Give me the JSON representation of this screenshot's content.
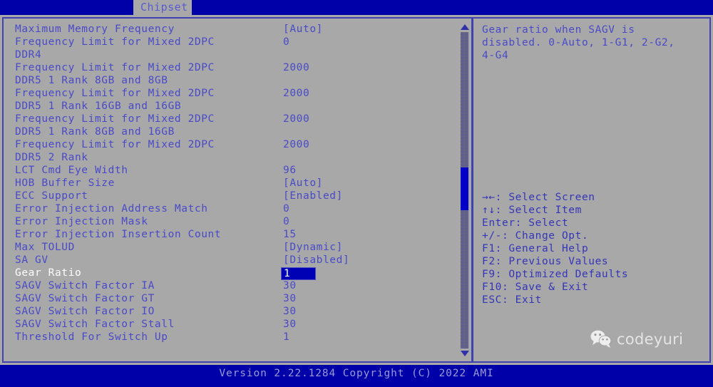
{
  "menu": {
    "active_tab": "Chipset",
    "tabs": [
      "Chipset"
    ]
  },
  "settings": {
    "rows": [
      {
        "label": "Maximum Memory Frequency",
        "value": "[Auto]",
        "selected": false
      },
      {
        "label": "Frequency Limit for Mixed 2DPC",
        "value": "0",
        "selected": false
      },
      {
        "label": "DDR4",
        "value": "",
        "selected": false
      },
      {
        "label": "Frequency Limit for Mixed 2DPC",
        "value": "2000",
        "selected": false
      },
      {
        "label": "DDR5 1 Rank 8GB and 8GB",
        "value": "",
        "selected": false
      },
      {
        "label": "Frequency Limit for Mixed 2DPC",
        "value": "2000",
        "selected": false
      },
      {
        "label": "DDR5 1 Rank 16GB and 16GB",
        "value": "",
        "selected": false
      },
      {
        "label": "Frequency Limit for Mixed 2DPC",
        "value": "2000",
        "selected": false
      },
      {
        "label": "DDR5 1 Rank 8GB and 16GB",
        "value": "",
        "selected": false
      },
      {
        "label": "Frequency Limit for Mixed 2DPC",
        "value": "2000",
        "selected": false
      },
      {
        "label": "DDR5 2 Rank",
        "value": "",
        "selected": false
      },
      {
        "label": "LCT Cmd Eye Width",
        "value": "96",
        "selected": false
      },
      {
        "label": "HOB Buffer Size",
        "value": "[Auto]",
        "selected": false
      },
      {
        "label": "ECC Support",
        "value": "[Enabled]",
        "selected": false
      },
      {
        "label": "Error Injection Address Match",
        "value": "0",
        "selected": false
      },
      {
        "label": "Error Injection Mask",
        "value": "0",
        "selected": false
      },
      {
        "label": "Error Injection Insertion Count",
        "value": "15",
        "selected": false
      },
      {
        "label": "Max TOLUD",
        "value": "[Dynamic]",
        "selected": false
      },
      {
        "label": "SA GV",
        "value": "[Disabled]",
        "selected": false
      },
      {
        "label": "Gear Ratio",
        "value": "1",
        "selected": true
      },
      {
        "label": "SAGV Switch Factor IA",
        "value": "30",
        "selected": false
      },
      {
        "label": "SAGV Switch Factor GT",
        "value": "30",
        "selected": false
      },
      {
        "label": "SAGV Switch Factor IO",
        "value": "30",
        "selected": false
      },
      {
        "label": "SAGV Switch Factor Stall",
        "value": "30",
        "selected": false
      },
      {
        "label": "Threshold For Switch Up",
        "value": "1",
        "selected": false
      }
    ]
  },
  "scrollbar": {
    "up_arrow": "scroll-up-arrow",
    "down_arrow": "scroll-down-arrow"
  },
  "help": {
    "lines": [
      "Gear ratio when SAGV is",
      "disabled. 0-Auto, 1-G1, 2-G2,",
      "4-G4"
    ],
    "hotkeys": [
      "→←: Select Screen",
      "↑↓: Select Item",
      "Enter: Select",
      "+/-: Change Opt.",
      "F1: General Help",
      "F2: Previous Values",
      "F9: Optimized Defaults",
      "F10: Save & Exit",
      "ESC: Exit"
    ]
  },
  "watermark": {
    "label": "codeyuri",
    "icon": "wechat-icon"
  },
  "footer": {
    "version_text": "Version 2.22.1284 Copyright (C) 2022 AMI"
  },
  "colors": {
    "menu_bar": "#0000a8",
    "background": "#a8a8a8",
    "text": "#4a4ac8",
    "selected_text": "#ffffff",
    "edit_field": "#0000b4",
    "border": "#4040b0"
  }
}
